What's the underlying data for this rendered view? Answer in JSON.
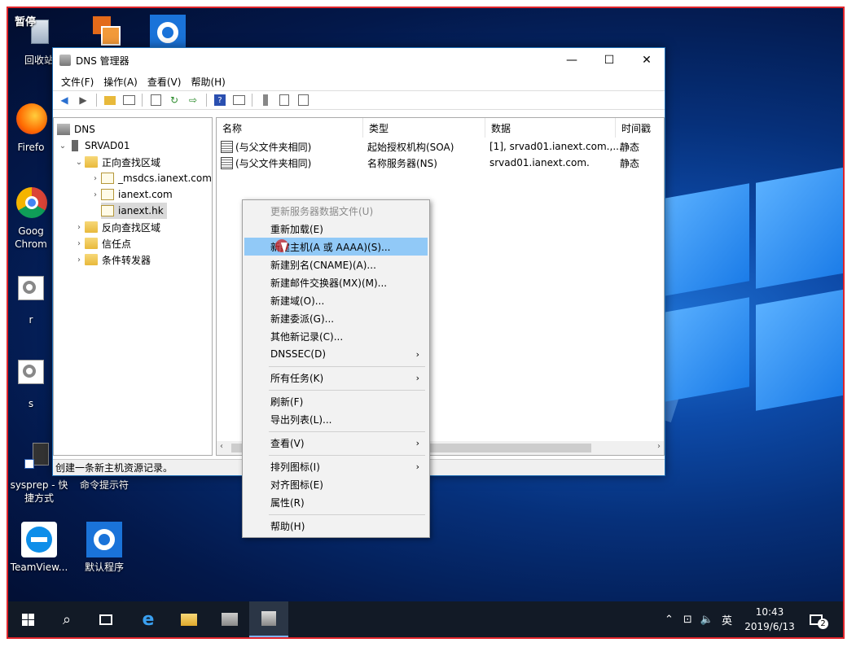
{
  "desktop": {
    "icons": [
      {
        "label": "回收站",
        "badge": "暂停"
      },
      {
        "label": ""
      },
      {
        "label": ""
      },
      {
        "label": "Firefo"
      },
      {
        "label": "Goog Chrom"
      },
      {
        "label": "r"
      },
      {
        "label": "s"
      },
      {
        "label": "sysprep - 快捷方式"
      },
      {
        "label": "命令提示符"
      },
      {
        "label": "TeamView..."
      },
      {
        "label": "默认程序"
      }
    ]
  },
  "window": {
    "title": "DNS 管理器",
    "controls": {
      "minimize": "—",
      "maximize": "☐",
      "close": "✕"
    },
    "menu": [
      "文件(F)",
      "操作(A)",
      "查看(V)",
      "帮助(H)"
    ],
    "tree": [
      {
        "label": "DNS",
        "level": 0
      },
      {
        "label": "SRVAD01",
        "level": 1,
        "expanded": true
      },
      {
        "label": "正向查找区域",
        "level": 2,
        "expanded": true
      },
      {
        "label": "_msdcs.ianext.com",
        "level": 3
      },
      {
        "label": "ianext.com",
        "level": 3
      },
      {
        "label": "ianext.hk",
        "level": 3,
        "selected": true
      },
      {
        "label": "反向查找区域",
        "level": 2
      },
      {
        "label": "信任点",
        "level": 2
      },
      {
        "label": "条件转发器",
        "level": 2
      }
    ],
    "list": {
      "columns": [
        "名称",
        "类型",
        "数据",
        "时间戳"
      ],
      "rows": [
        {
          "name": "(与父文件夹相同)",
          "type": "起始授权机构(SOA)",
          "data": "[1], srvad01.ianext.com.,...",
          "timestamp": "静态"
        },
        {
          "name": "(与父文件夹相同)",
          "type": "名称服务器(NS)",
          "data": "srvad01.ianext.com.",
          "timestamp": "静态"
        }
      ]
    },
    "status": "创建一条新主机资源记录。"
  },
  "context_menu": {
    "items": [
      {
        "label": "更新服务器数据文件(U)",
        "disabled": true
      },
      {
        "label": "重新加载(E)"
      },
      {
        "label": "新建主机(A 或 AAAA)(S)...",
        "highlighted": true
      },
      {
        "label": "新建别名(CNAME)(A)..."
      },
      {
        "label": "新建邮件交换器(MX)(M)..."
      },
      {
        "label": "新建域(O)..."
      },
      {
        "label": "新建委派(G)..."
      },
      {
        "label": "其他新记录(C)..."
      },
      {
        "label": "DNSSEC(D)",
        "submenu": true
      },
      {
        "label": "所有任务(K)",
        "submenu": true
      },
      {
        "label": "刷新(F)"
      },
      {
        "label": "导出列表(L)..."
      },
      {
        "label": "查看(V)",
        "submenu": true
      },
      {
        "label": "排列图标(I)",
        "submenu": true
      },
      {
        "label": "对齐图标(E)"
      },
      {
        "label": "属性(R)"
      },
      {
        "label": "帮助(H)"
      }
    ]
  },
  "taskbar": {
    "ime": "英",
    "time": "10:43",
    "date": "2019/6/13",
    "notifications": "2"
  }
}
